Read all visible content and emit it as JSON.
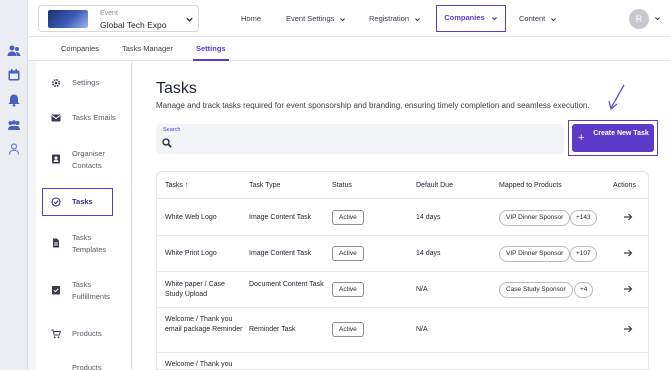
{
  "event": {
    "caption": "Event",
    "name": "Global Tech Expo"
  },
  "nav": {
    "home": "Home",
    "event_settings": "Event Settings",
    "registration": "Registration",
    "companies": "Companies",
    "content": "Content"
  },
  "user": {
    "initial": "R"
  },
  "subtabs": [
    "Companies",
    "Tasks Manager",
    "Settings"
  ],
  "sidebar": {
    "items": [
      {
        "label": "Settings",
        "icon": "gear-icon"
      },
      {
        "label": "Tasks Emails",
        "icon": "mail-icon"
      },
      {
        "label": "Organiser Contacts",
        "icon": "contact-icon"
      },
      {
        "label": "Tasks",
        "icon": "task-check-icon"
      },
      {
        "label": "Tasks Templates",
        "icon": "template-icon"
      },
      {
        "label": "Tasks Fulfillments",
        "icon": "fulfillment-icon"
      },
      {
        "label": "Products",
        "icon": "cart-icon"
      },
      {
        "label": "Products",
        "icon": "product-icon"
      }
    ]
  },
  "page": {
    "title": "Tasks",
    "description": "Manage and track tasks required for event sponsorship and branding, ensuring timely completion and seamless execution."
  },
  "search": {
    "label": "Search"
  },
  "create_button": {
    "label": "Create New Task"
  },
  "table": {
    "headers": {
      "task": "Tasks ↑",
      "type": "Task Type",
      "status": "Status",
      "due": "Default Due",
      "mapped": "Mapped to Products",
      "actions": "Actions"
    },
    "rows": [
      {
        "name": "White Web Logo",
        "type": "Image Content Task",
        "status": "Active",
        "due": "14 days",
        "product": "VIP Dinner Sponsor",
        "more": "+143"
      },
      {
        "name": "White Print Logo",
        "type": "Image Content Task",
        "status": "Active",
        "due": "14 days",
        "product": "VIP Dinner Sponsor",
        "more": "+107"
      },
      {
        "name": "White paper / Case Study Upload",
        "type": "Document Content Task",
        "status": "Active",
        "due": "N/A",
        "product": "Case Study Sponsor",
        "more": "+4"
      },
      {
        "name": "Welcome / Thank you email package Reminder",
        "type": "Reminder Task",
        "status": "Active",
        "due": "N/A",
        "product": "",
        "more": ""
      },
      {
        "name": "Welcome / Thank you",
        "type": "",
        "status": "",
        "due": "",
        "product": "",
        "more": ""
      }
    ]
  },
  "colors": {
    "accent": "#5b3bc7",
    "rail_icon": "#4a5fc1"
  }
}
